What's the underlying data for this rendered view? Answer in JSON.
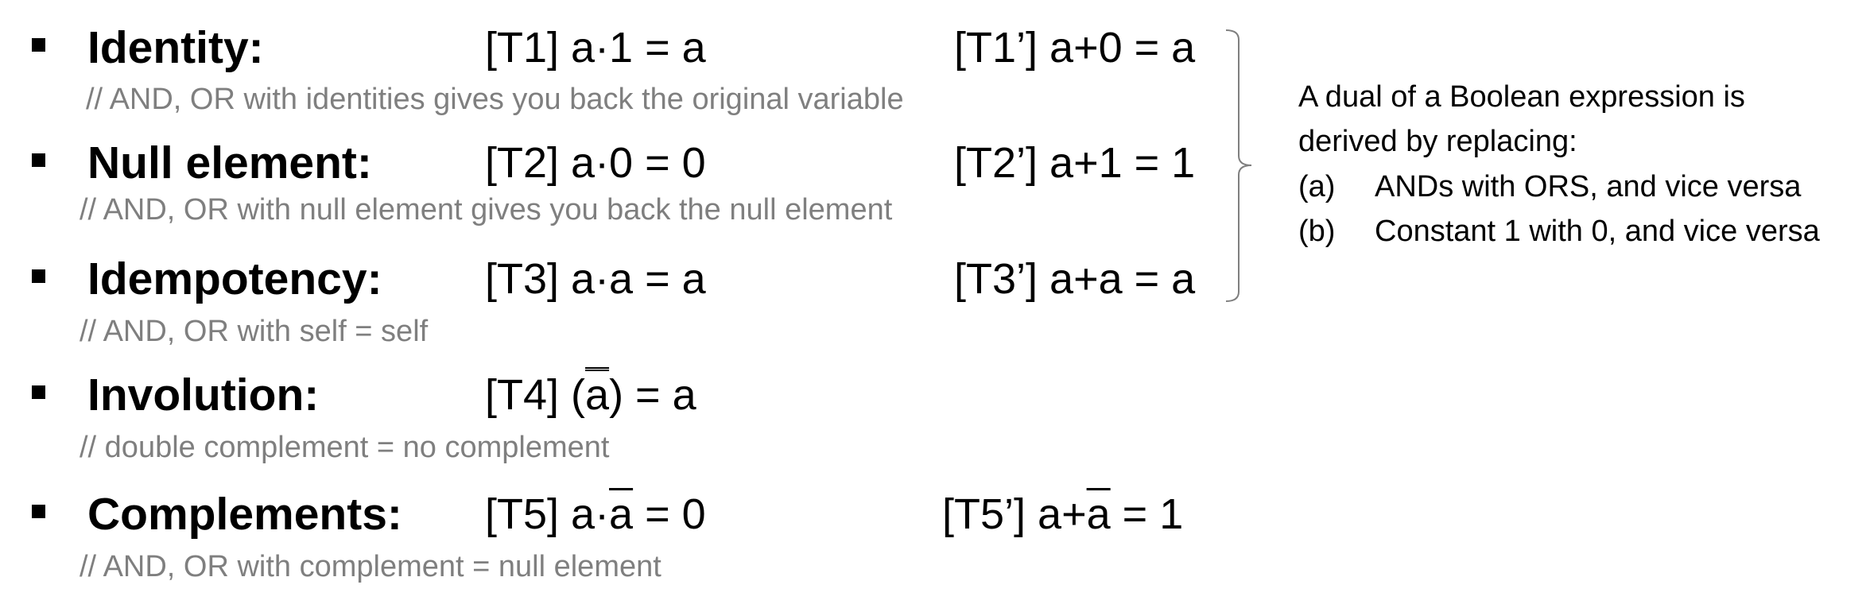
{
  "rows": [
    {
      "term": "Identity:",
      "law": {
        "label": "[T1] ",
        "expr": "a·1 = a"
      },
      "dual": {
        "label": "[T1’] ",
        "expr": "a+0 = a"
      },
      "comment": "// AND, OR with identities gives you back the original variable"
    },
    {
      "term": "Null element:",
      "law": {
        "label": "[T2] ",
        "expr": "a·0 = 0"
      },
      "dual": {
        "label": "[T2’] ",
        "expr": "a+1 = 1"
      },
      "comment": "// AND, OR with null element gives you back the null element"
    },
    {
      "term": "Idempotency:",
      "law": {
        "label": "[T3] ",
        "expr": "a·a = a"
      },
      "dual": {
        "label": "[T3’] ",
        "expr": "a+a = a"
      },
      "comment": "// AND, OR with self = self"
    },
    {
      "term": "Involution:",
      "law": {
        "label": "[T4] ",
        "pre": "(",
        "barred": "a",
        "post": ") = a"
      },
      "comment": "// double complement = no complement"
    },
    {
      "term": "Complements:",
      "law": {
        "label": "[T5] ",
        "pre": "a·",
        "barred": "a",
        "post": " = 0"
      },
      "dual": {
        "label": "[T5’] ",
        "pre": "a+",
        "barred": "a",
        "post": " = 1"
      },
      "comment": "// AND, OR with complement = null element"
    }
  ],
  "dual_note": {
    "line1": "A dual of a Boolean expression is",
    "line2": "derived by replacing:",
    "items": [
      {
        "marker": "(a)",
        "text": "ANDs with ORS, and vice versa"
      },
      {
        "marker": "(b)",
        "text": "Constant 1 with 0, and vice versa"
      }
    ]
  }
}
